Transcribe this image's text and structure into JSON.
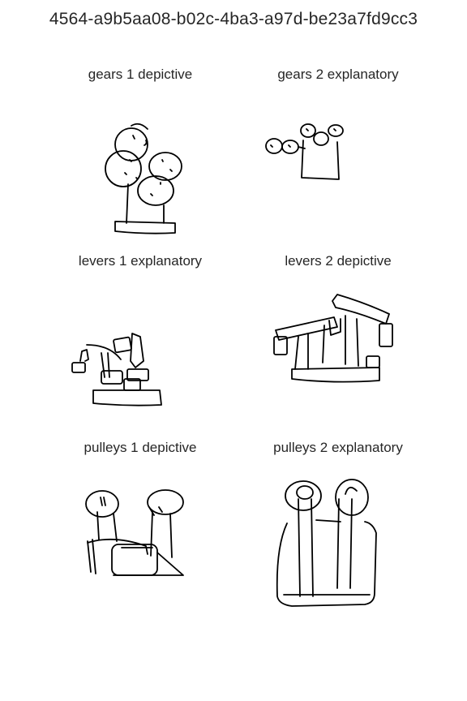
{
  "title": "4564-a9b5aa08-b02c-4ba3-a97d-be23a7fd9cc3",
  "panels": [
    {
      "label": "gears 1 depictive"
    },
    {
      "label": "gears 2 explanatory"
    },
    {
      "label": "levers 1 explanatory"
    },
    {
      "label": "levers 2 depictive"
    },
    {
      "label": "pulleys 1 depictive"
    },
    {
      "label": "pulleys 2 explanatory"
    }
  ]
}
